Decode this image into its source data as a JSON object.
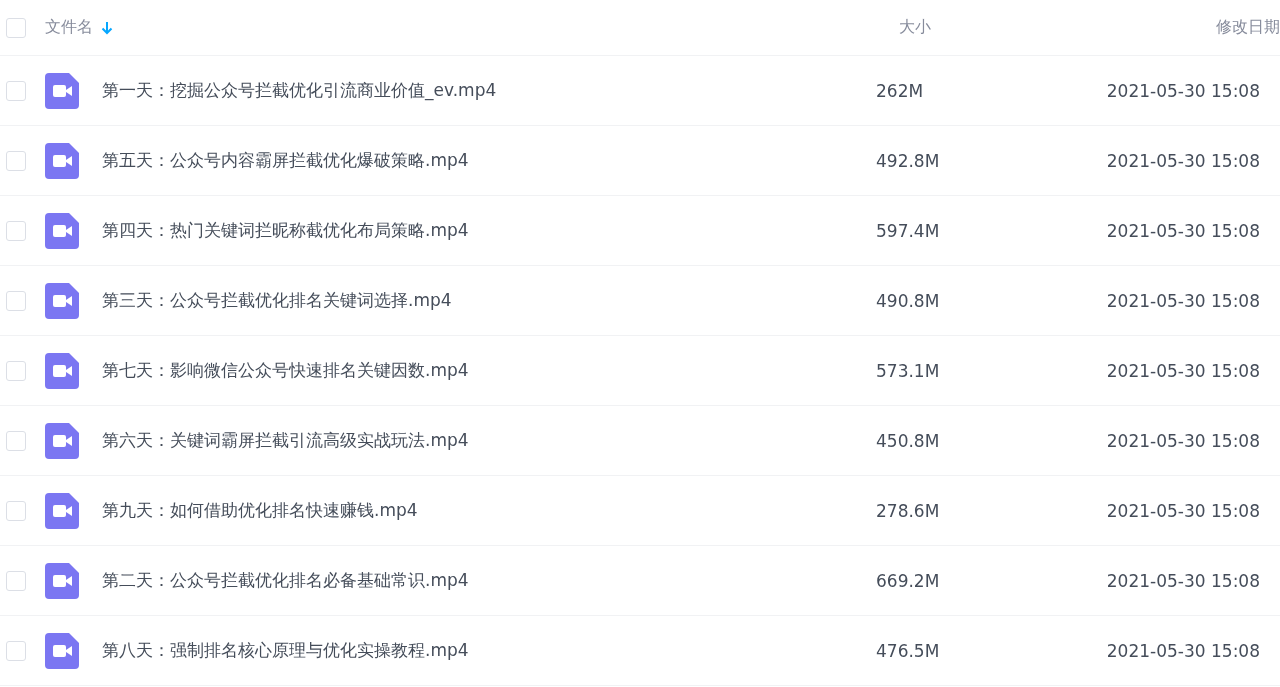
{
  "header": {
    "checked": false,
    "columns": [
      {
        "label": "文件名",
        "sorted": true
      },
      {
        "label": "大小",
        "sorted": false
      },
      {
        "label": "修改日期",
        "sorted": false
      }
    ]
  },
  "files": [
    {
      "name": "第一天：挖掘公众号拦截优化引流商业价值_ev.mp4",
      "size": "262M",
      "modified": "2021-05-30 15:08",
      "checked": false
    },
    {
      "name": "第五天：公众号内容霸屏拦截优化爆破策略.mp4",
      "size": "492.8M",
      "modified": "2021-05-30 15:08",
      "checked": false
    },
    {
      "name": "第四天：热门关键词拦昵称截优化布局策略.mp4",
      "size": "597.4M",
      "modified": "2021-05-30 15:08",
      "checked": false
    },
    {
      "name": "第三天：公众号拦截优化排名关键词选择.mp4",
      "size": "490.8M",
      "modified": "2021-05-30 15:08",
      "checked": false
    },
    {
      "name": "第七天：影响微信公众号快速排名关键因数.mp4",
      "size": "573.1M",
      "modified": "2021-05-30 15:08",
      "checked": false
    },
    {
      "name": "第六天：关键词霸屏拦截引流高级实战玩法.mp4",
      "size": "450.8M",
      "modified": "2021-05-30 15:08",
      "checked": false
    },
    {
      "name": "第九天：如何借助优化排名快速赚钱.mp4",
      "size": "278.6M",
      "modified": "2021-05-30 15:08",
      "checked": false
    },
    {
      "name": "第二天：公众号拦截优化排名必备基础常识.mp4",
      "size": "669.2M",
      "modified": "2021-05-30 15:08",
      "checked": false
    },
    {
      "name": "第八天：强制排名核心原理与优化实操教程.mp4",
      "size": "476.5M",
      "modified": "2021-05-30 15:08",
      "checked": false
    }
  ]
}
